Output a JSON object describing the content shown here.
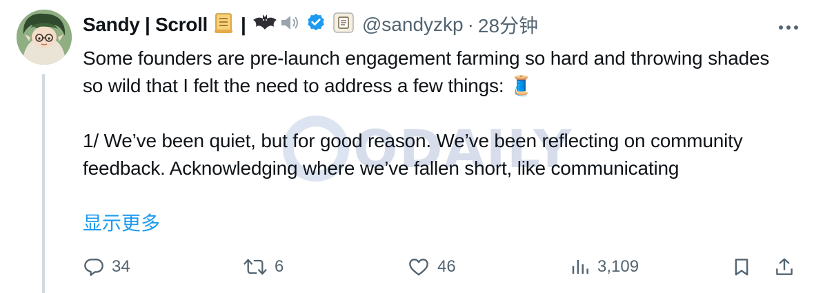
{
  "author": {
    "name": "Sandy | Scroll",
    "separator": "|",
    "handle": "@sandyzkp",
    "dot": "·",
    "time": "28分钟",
    "verified_color": "#1d9bf0"
  },
  "more_icon": "more-horizontal-icon",
  "tweet": {
    "line1": "Some founders are pre-launch engagement farming so hard and throwing shades so wild that I felt the need to address a few things: 🧵",
    "line2": "1/ We’ve been quiet, but for good reason. We’ve been reflecting on community feedback. Acknowledging where we’ve fallen short, like communicating",
    "show_more": "显示更多"
  },
  "actions": {
    "reply_count": "34",
    "retweet_count": "6",
    "like_count": "46",
    "view_count": "3,109"
  },
  "watermark": {
    "text": "ODAILY"
  },
  "colors": {
    "accent": "#1d9bf0",
    "secondary_text": "#536471",
    "thread_line": "#cfd9de"
  }
}
